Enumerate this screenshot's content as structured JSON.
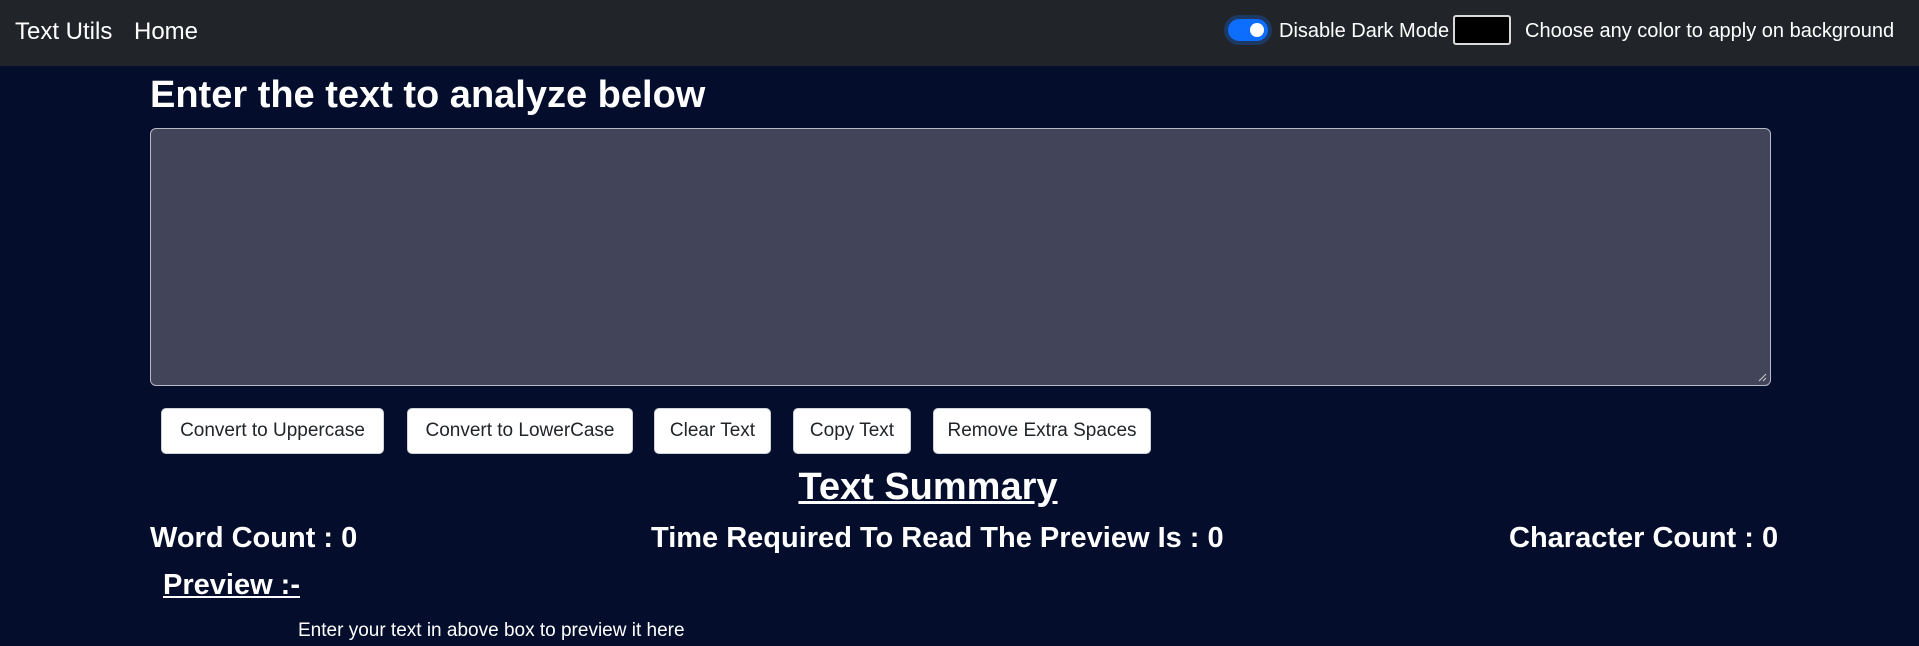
{
  "navbar": {
    "brand": "Text Utils",
    "home_link": "Home",
    "dark_mode_label": "Disable Dark Mode",
    "dark_mode_on": true,
    "background_color_value": "#000000",
    "background_color_label": "Choose any color to apply on background"
  },
  "main": {
    "heading": "Enter the text to analyze below",
    "textarea_value": "",
    "buttons": {
      "uppercase": "Convert to Uppercase",
      "lowercase": "Convert to LowerCase",
      "clear": "Clear Text",
      "copy": "Copy Text",
      "remove_spaces": "Remove Extra Spaces"
    }
  },
  "summary": {
    "title": "Text Summary",
    "word_count": "Word Count : 0",
    "read_time": "Time Required To Read The Preview Is : 0",
    "char_count": "Character Count : 0"
  },
  "preview": {
    "title": "Preview :-",
    "text": "Enter your text in above box to preview it here"
  },
  "colors": {
    "page_background": "#040e2c",
    "navbar_background": "#212529",
    "textarea_background": "#424459",
    "toggle_accent": "#0d6efd"
  }
}
